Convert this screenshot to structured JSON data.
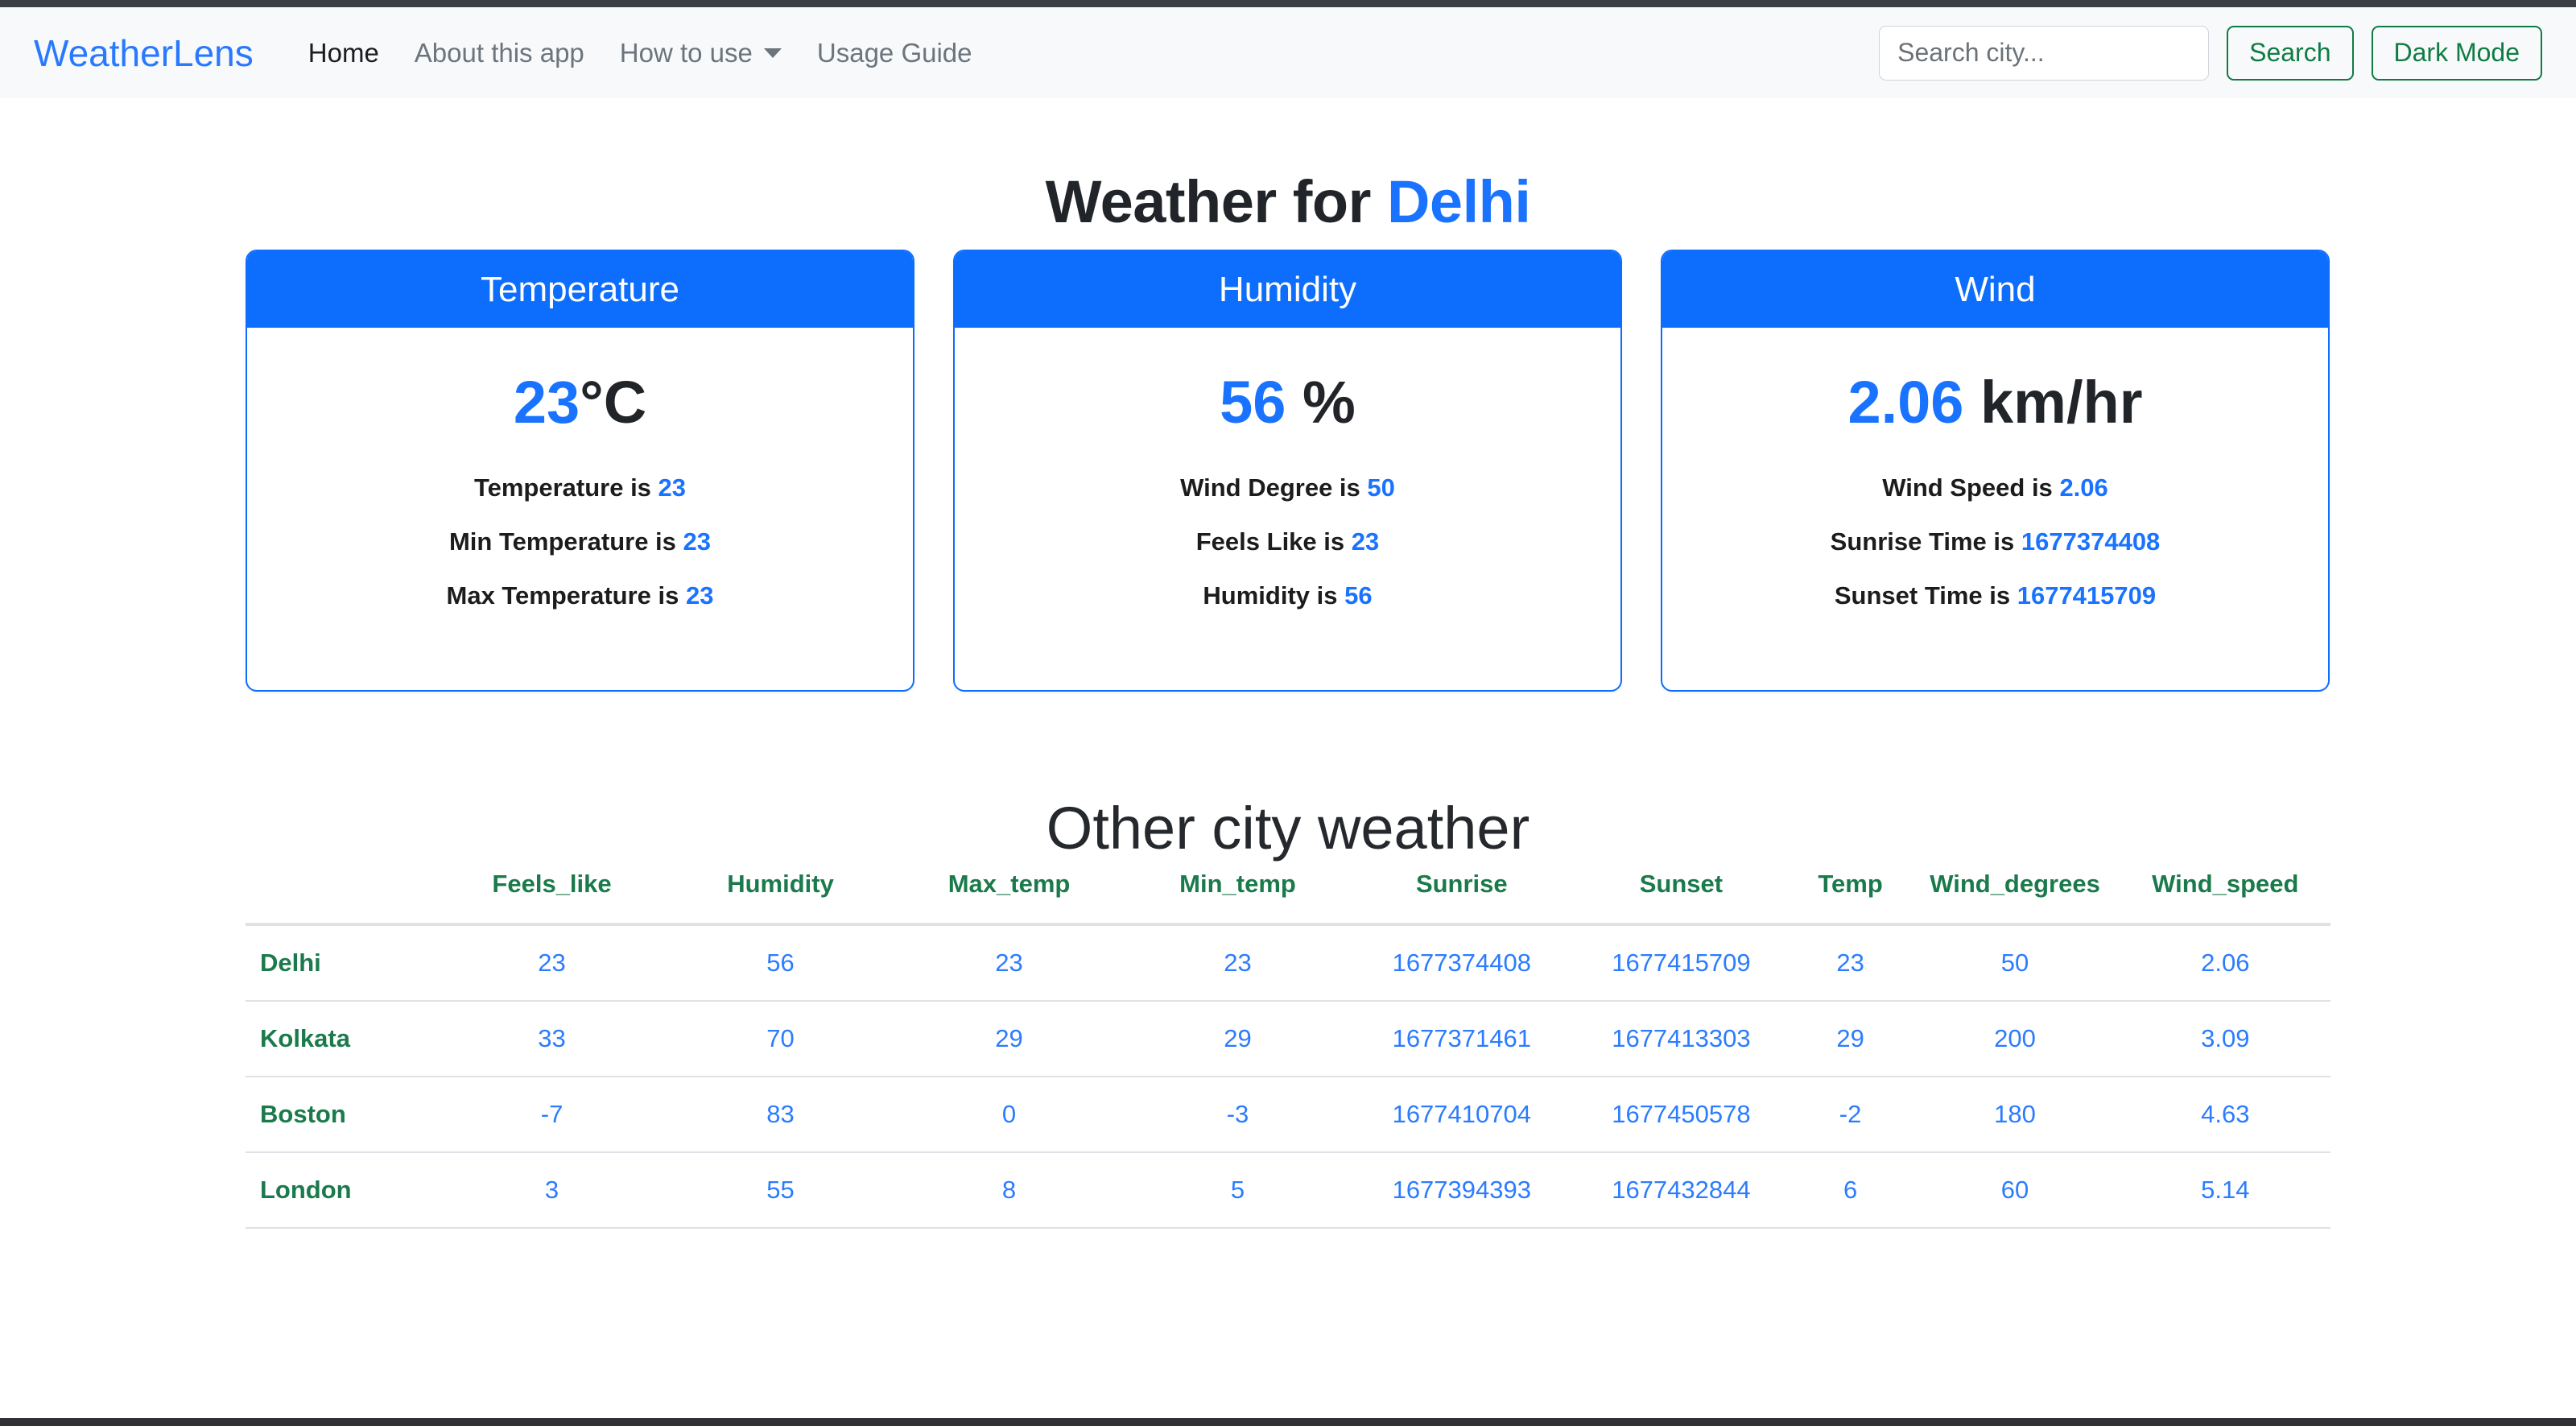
{
  "chrome": {
    "top_strip_color": "#3c3f43",
    "bottom_strip_color": "#2f3134"
  },
  "navbar": {
    "brand": "WeatherLens",
    "links": [
      {
        "label": "Home",
        "active": true
      },
      {
        "label": "About this app",
        "active": false
      },
      {
        "label": "How to use",
        "active": false,
        "has_dropdown": true
      },
      {
        "label": "Usage Guide",
        "active": false
      }
    ],
    "search": {
      "value": "",
      "placeholder": "Search city..."
    },
    "search_button": "Search",
    "dark_mode_button": "Dark Mode"
  },
  "header": {
    "title_prefix": "Weather for",
    "city": "Delhi"
  },
  "cards": [
    {
      "title": "Temperature",
      "value": "23",
      "unit": "°C",
      "details": [
        {
          "label": "Temperature is",
          "value": "23"
        },
        {
          "label": "Min Temperature is",
          "value": "23"
        },
        {
          "label": "Max Temperature is",
          "value": "23"
        }
      ]
    },
    {
      "title": "Humidity",
      "value": "56",
      "unit": "%",
      "details": [
        {
          "label": "Wind Degree is",
          "value": "50"
        },
        {
          "label": "Feels Like is",
          "value": "23"
        },
        {
          "label": "Humidity is",
          "value": "56"
        }
      ]
    },
    {
      "title": "Wind",
      "value": "2.06",
      "unit": "km/hr",
      "details": [
        {
          "label": "Wind Speed is",
          "value": "2.06"
        },
        {
          "label": "Sunrise Time is",
          "value": "1677374408"
        },
        {
          "label": "Sunset Time is",
          "value": "1677415709"
        }
      ]
    }
  ],
  "other_cities": {
    "title": "Other city weather",
    "columns": [
      "",
      "Feels_like",
      "Humidity",
      "Max_temp",
      "Min_temp",
      "Sunrise",
      "Sunset",
      "Temp",
      "Wind_degrees",
      "Wind_speed"
    ],
    "rows": [
      {
        "city": "Delhi",
        "feels_like": "23",
        "humidity": "56",
        "max_temp": "23",
        "min_temp": "23",
        "sunrise": "1677374408",
        "sunset": "1677415709",
        "temp": "23",
        "wind_degrees": "50",
        "wind_speed": "2.06"
      },
      {
        "city": "Kolkata",
        "feels_like": "33",
        "humidity": "70",
        "max_temp": "29",
        "min_temp": "29",
        "sunrise": "1677371461",
        "sunset": "1677413303",
        "temp": "29",
        "wind_degrees": "200",
        "wind_speed": "3.09"
      },
      {
        "city": "Boston",
        "feels_like": "-7",
        "humidity": "83",
        "max_temp": "0",
        "min_temp": "-3",
        "sunrise": "1677410704",
        "sunset": "1677450578",
        "temp": "-2",
        "wind_degrees": "180",
        "wind_speed": "4.63"
      },
      {
        "city": "London",
        "feels_like": "3",
        "humidity": "55",
        "max_temp": "8",
        "min_temp": "5",
        "sunrise": "1677394393",
        "sunset": "1677432844",
        "temp": "6",
        "wind_degrees": "60",
        "wind_speed": "5.14"
      }
    ]
  },
  "colors": {
    "primary_blue": "#0d6efd",
    "link_blue": "#1a73ff",
    "brand_blue": "#2979ff",
    "green": "#1b7a4b",
    "button_green": "#0f7c43",
    "navbar_bg": "#f8f9fa"
  }
}
